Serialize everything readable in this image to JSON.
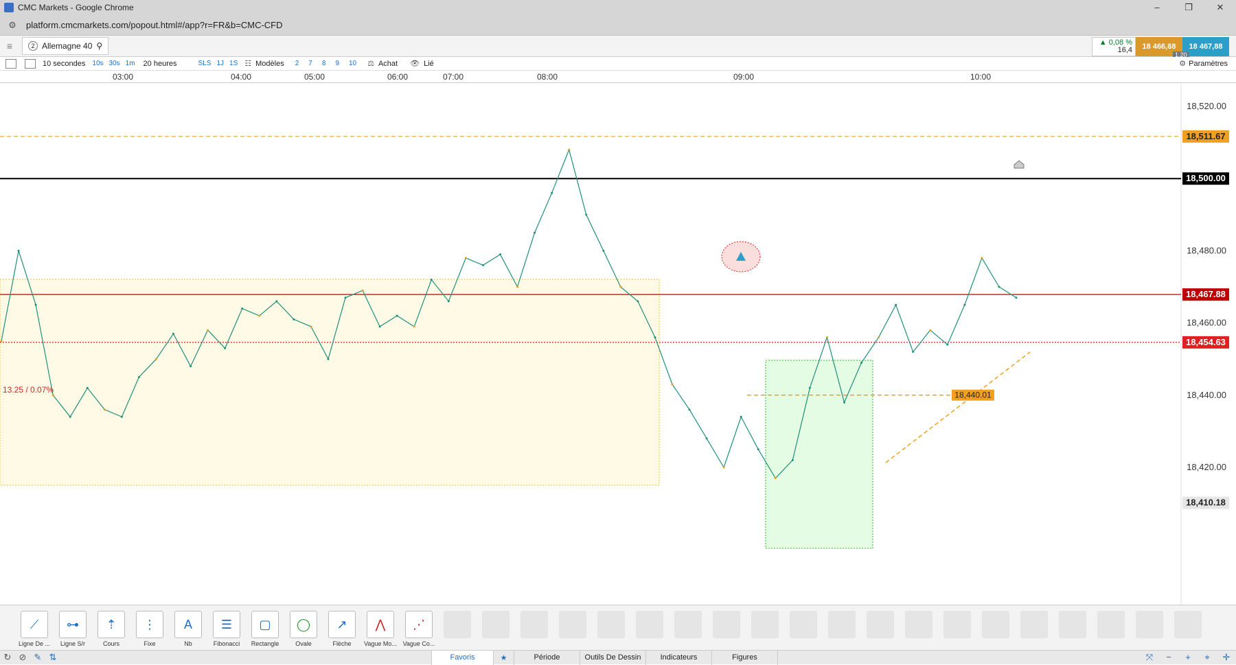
{
  "window": {
    "title": "CMC Markets - Google Chrome",
    "minimize": "–",
    "restore": "❐",
    "close": "✕"
  },
  "address": {
    "url": "platform.cmcmarkets.com/popout.html#/app?r=FR&b=CMC-CFD"
  },
  "instrument": {
    "badge": "2",
    "name": "Allemagne 40"
  },
  "quote": {
    "change_pct": "▲ 0,08 %",
    "change_pts": "16,4",
    "sell": "18 466,68",
    "buy": "18 467,88",
    "spread": "1.20"
  },
  "toolbar": {
    "interval": "10 secondes",
    "quick_intervals": [
      "10s",
      "30s",
      "1m"
    ],
    "range": "20 heures",
    "quick_ranges": [
      "SLS",
      "1J",
      "1S"
    ],
    "templates": "Modèles",
    "template_slots": [
      "2",
      "7",
      "8",
      "9",
      "10"
    ],
    "side": "Achat",
    "linked": "Lié",
    "settings": "Paramètres"
  },
  "time_axis": [
    "03:00",
    "04:00",
    "05:00",
    "06:00",
    "07:00",
    "08:00",
    "09:00",
    "10:00"
  ],
  "chart_data": {
    "type": "line",
    "price_ticks": [
      "18,520.00",
      "18,480.00",
      "18,460.00",
      "18,440.00",
      "18,420.00"
    ],
    "price_tick_values": [
      18520,
      18480,
      18460,
      18440,
      18420
    ],
    "levels": [
      {
        "label": "18,511.67",
        "value": 18511.67,
        "style": "dashed",
        "color": "#f0a020"
      },
      {
        "label": "18,500.00",
        "value": 18500.0,
        "style": "solid",
        "color": "#000000"
      },
      {
        "label": "18,467.88",
        "value": 18467.88,
        "style": "solid",
        "color": "#c00000"
      },
      {
        "label": "18,454.63",
        "value": 18454.63,
        "style": "dotted",
        "color": "#e02020"
      },
      {
        "label": "18,410.18",
        "value": 18410.18,
        "style": "none",
        "color": "#555555"
      }
    ],
    "annotation_pct": "13.25 / 0.07%",
    "marker_label": "18,440.01",
    "marker_value": 18440.01,
    "series": [
      {
        "values": [
          18455,
          18480,
          18465,
          18440,
          18434,
          18442,
          18436,
          18434,
          18445,
          18450,
          18457,
          18448,
          18458,
          18453,
          18464,
          18462,
          18466,
          18461,
          18459,
          18450,
          18467,
          18469,
          18459,
          18462,
          18459,
          18472,
          18466,
          18478,
          18476,
          18479,
          18470,
          18485,
          18496,
          18508,
          18490,
          18480,
          18470,
          18466,
          18456,
          18443,
          18436,
          18428,
          18420,
          18434,
          18425,
          18417,
          18422,
          18442,
          18456,
          18438,
          18449,
          18456,
          18465,
          18452,
          18458,
          18454,
          18465,
          18478,
          18470,
          18467
        ]
      }
    ]
  },
  "drawing_tools": [
    "Ligne De ...",
    "Ligne S/r",
    "Cours",
    "Fixe",
    "Nb",
    "Fibonacci",
    "Rectangle",
    "Ovale",
    "Flèche",
    "Vague Mo...",
    "Vague Co..."
  ],
  "tool_icons": [
    "trend-line",
    "sr-line",
    "price-tag",
    "fixed-line",
    "text",
    "fibonacci",
    "rectangle",
    "ellipse",
    "arrow",
    "wave",
    "wave-co"
  ],
  "footer": {
    "favoris": "Favoris",
    "periode": "Période",
    "outils": "Outils De Dessin",
    "indicateurs": "Indicateurs",
    "figures": "Figures"
  }
}
